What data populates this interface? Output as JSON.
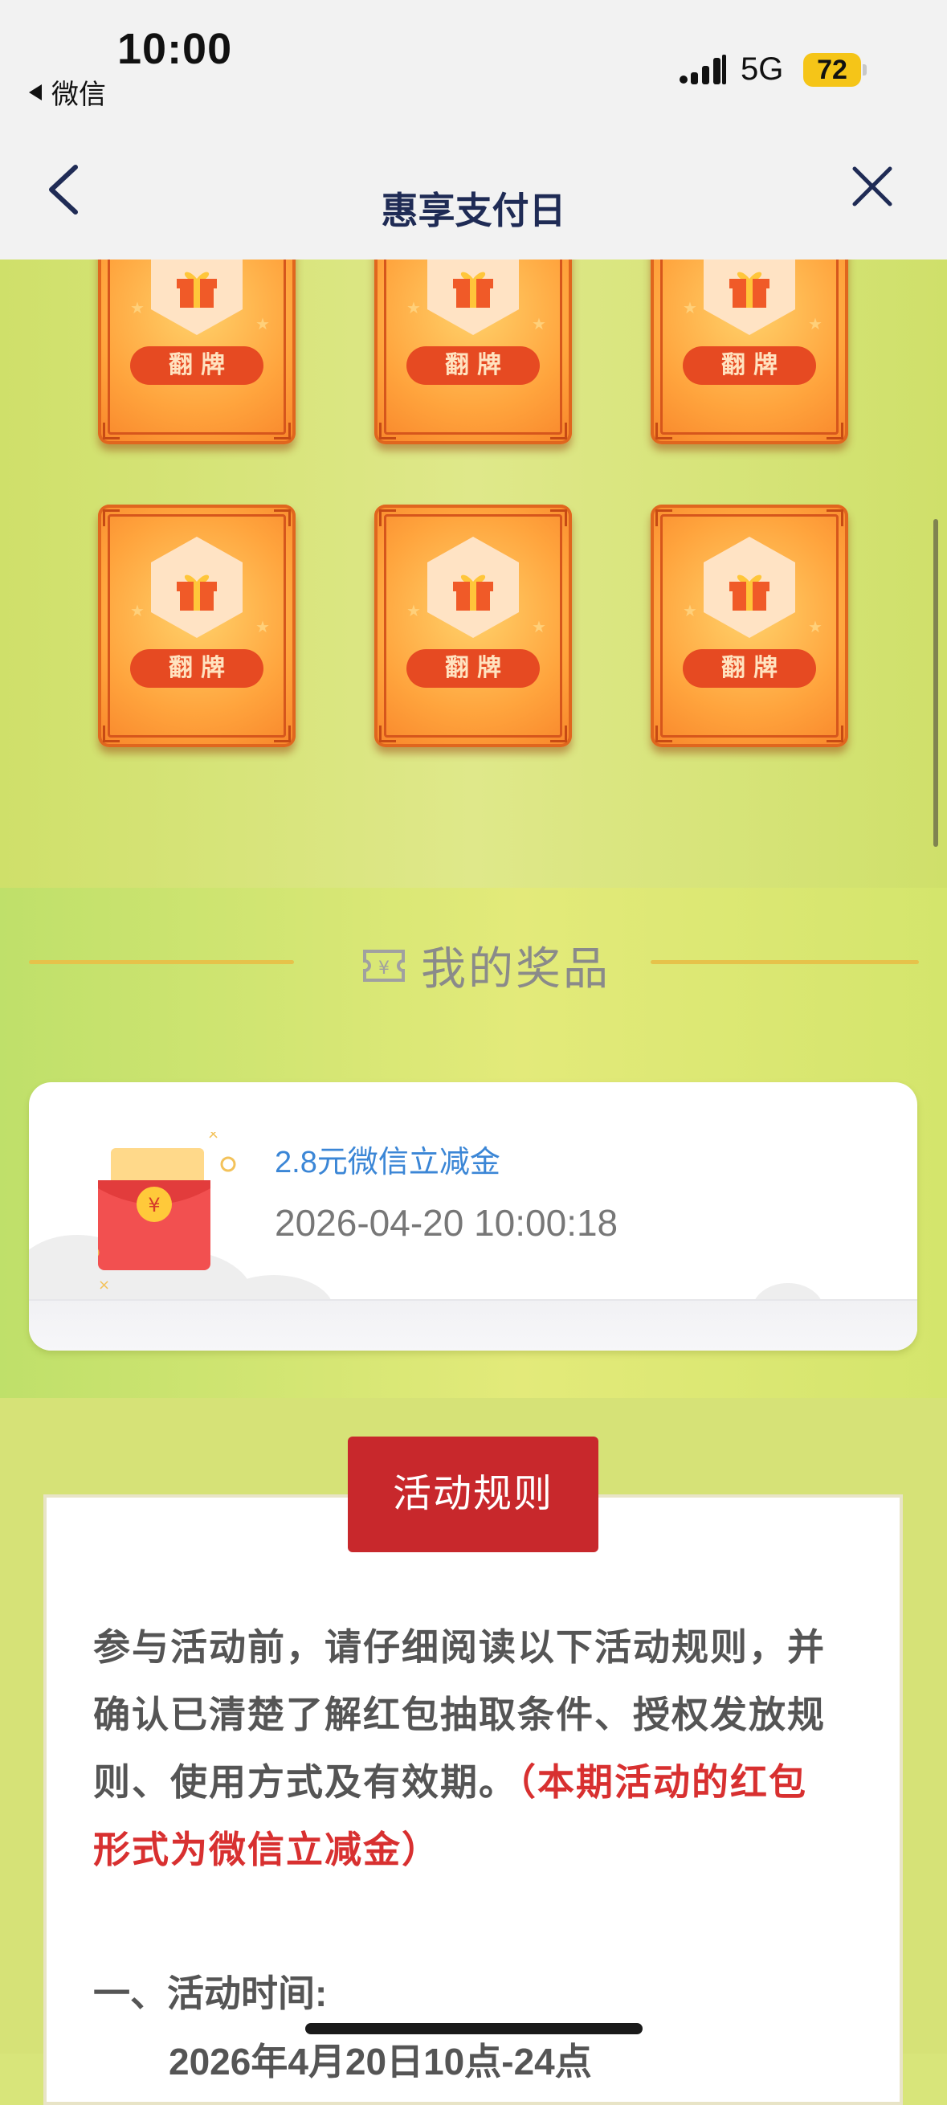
{
  "status_bar": {
    "time": "10:00",
    "back_app": "微信",
    "network": "5G",
    "battery": "72"
  },
  "nav": {
    "title": "惠享支付日"
  },
  "cards": {
    "flip_label": "翻牌",
    "count": 6
  },
  "prizes": {
    "section_title": "我的奖品",
    "items": [
      {
        "name": "2.8元微信立减金",
        "time": "2026-04-20 10:00:18"
      }
    ]
  },
  "rules": {
    "tab_label": "活动规则",
    "intro": "参与活动前，请仔细阅读以下活动规则，并确认已清楚了解红包抽取条件、授权发放规则、使用方式及有效期。",
    "intro_highlight": "（本期活动的红包形式为微信立减金）",
    "section1_heading": "一、活动时间:",
    "section1_partial": "2026年4月20日10点-24点"
  },
  "colors": {
    "page_bg": "#d8e57a",
    "card_orange": "#ffa43d",
    "flip_button": "#e64a22",
    "rules_tab": "#c8282c",
    "prize_link": "#3b86d6",
    "highlight_red": "#d83030"
  }
}
